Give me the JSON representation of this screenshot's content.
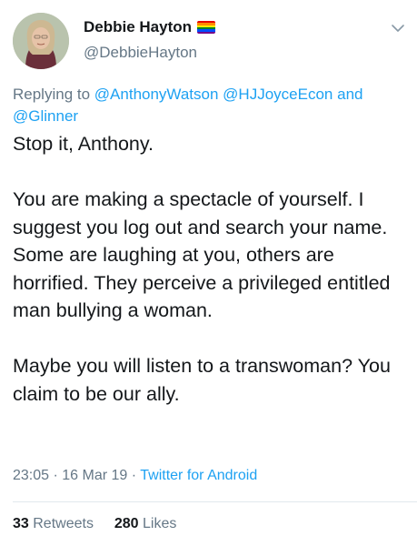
{
  "author": {
    "display_name": "Debbie Hayton",
    "handle": "@DebbieHayton",
    "flag_colors": [
      "#e40303",
      "#ff8c00",
      "#ffed00",
      "#008026",
      "#004dff",
      "#750787"
    ]
  },
  "replying": {
    "prefix": "Replying to",
    "mention_1": "@AnthonyWatson",
    "mention_2": "@HJJoyceEcon",
    "conjunction": "and",
    "mention_3": "@Glinner"
  },
  "tweet_text": "Stop it, Anthony.\n\nYou are making a spectacle of yourself. I suggest you log out and search your name. Some are laughing at you, others are horrified. They perceive a privileged entitled man bullying a woman.\n\nMaybe you will listen to a transwoman? You claim to be our ally.",
  "meta": {
    "time": "23:05",
    "separator": "·",
    "date": "16 Mar 19",
    "source": "Twitter for Android"
  },
  "stats": {
    "retweets_count": "33",
    "retweets_label": "Retweets",
    "likes_count": "280",
    "likes_label": "Likes"
  },
  "colors": {
    "link": "#1da1f2",
    "secondary": "#657786",
    "text": "#14171a"
  }
}
